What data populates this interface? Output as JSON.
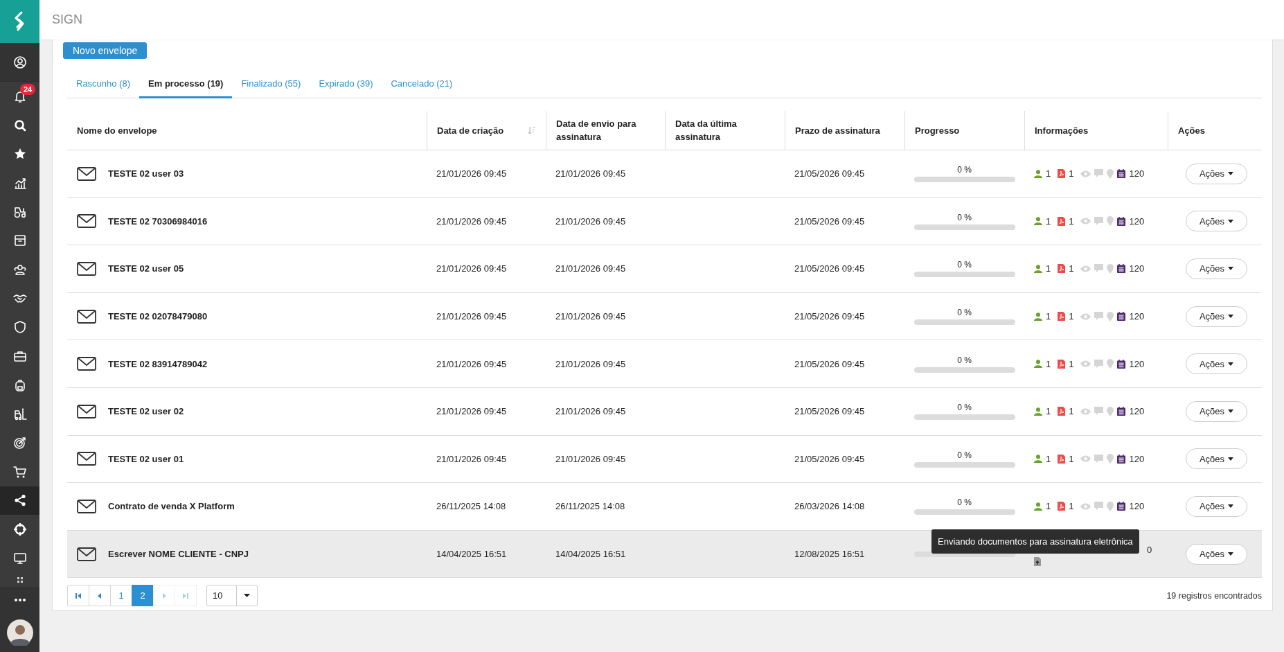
{
  "sidebar": {
    "items": [
      {
        "selected": false
      },
      {
        "selected": false,
        "badge": "24"
      },
      {
        "selected": false
      },
      {
        "selected": false
      },
      {
        "selected": false
      },
      {
        "selected": false
      },
      {
        "selected": false
      },
      {
        "selected": false
      },
      {
        "selected": false
      },
      {
        "selected": false
      },
      {
        "selected": false
      },
      {
        "selected": false
      },
      {
        "selected": false
      },
      {
        "selected": false
      },
      {
        "selected": false
      },
      {
        "selected": true
      },
      {
        "selected": false
      },
      {
        "selected": false
      },
      {
        "selected": false
      },
      {
        "selected": false
      }
    ]
  },
  "header": {
    "title": "SIGN"
  },
  "new_button": "Novo envelope",
  "tabs": [
    {
      "label": "Rascunho (8)",
      "selected": false
    },
    {
      "label": "Em processo (19)",
      "selected": true
    },
    {
      "label": "Finalizado (55)",
      "selected": false
    },
    {
      "label": "Expirado (39)",
      "selected": false
    },
    {
      "label": "Cancelado (21)",
      "selected": false
    }
  ],
  "table": {
    "columns": [
      {
        "label": "Nome do envelope"
      },
      {
        "label": "Data de criação",
        "sort_icon": true
      },
      {
        "label": "Data de envio para assinatura"
      },
      {
        "label": "Data da última assinatura"
      },
      {
        "label": "Prazo de assinatura"
      },
      {
        "label": "Progresso"
      },
      {
        "label": "Informações"
      },
      {
        "label": "Ações"
      }
    ],
    "rows": [
      {
        "kind": "normal",
        "hovered": false,
        "name": "TESTE 02 user 03",
        "created": "21/01/2026 09:45",
        "sent": "21/01/2026 09:45",
        "deadline": "21/05/2026 09:45",
        "progress_text": "0 %",
        "level": 0,
        "signers": "1",
        "documents": "1",
        "viewed": false,
        "commented": false,
        "located": false,
        "days": "120",
        "action": "Ações"
      },
      {
        "kind": "normal",
        "hovered": false,
        "name": "TESTE 02 70306984016",
        "created": "21/01/2026 09:45",
        "sent": "21/01/2026 09:45",
        "deadline": "21/05/2026 09:45",
        "progress_text": "0 %",
        "level": 0,
        "signers": "1",
        "documents": "1",
        "viewed": false,
        "commented": false,
        "located": false,
        "days": "120",
        "action": "Ações"
      },
      {
        "kind": "normal",
        "hovered": false,
        "name": "TESTE 02 user 05",
        "created": "21/01/2026 09:45",
        "sent": "21/01/2026 09:45",
        "deadline": "21/05/2026 09:45",
        "progress_text": "0 %",
        "level": 0,
        "signers": "1",
        "documents": "1",
        "viewed": false,
        "commented": false,
        "located": false,
        "days": "120",
        "action": "Ações"
      },
      {
        "kind": "normal",
        "hovered": false,
        "name": "TESTE 02 02078479080",
        "created": "21/01/2026 09:45",
        "sent": "21/01/2026 09:45",
        "deadline": "21/05/2026 09:45",
        "progress_text": "0 %",
        "level": 0,
        "signers": "1",
        "documents": "1",
        "viewed": false,
        "commented": false,
        "located": false,
        "days": "120",
        "action": "Ações"
      },
      {
        "kind": "normal",
        "hovered": false,
        "name": "TESTE 02 83914789042",
        "created": "21/01/2026 09:45",
        "sent": "21/01/2026 09:45",
        "deadline": "21/05/2026 09:45",
        "progress_text": "0 %",
        "level": 0,
        "signers": "1",
        "documents": "1",
        "viewed": false,
        "commented": false,
        "located": false,
        "days": "120",
        "action": "Ações"
      },
      {
        "kind": "normal",
        "hovered": false,
        "name": "TESTE 02 user 02",
        "created": "21/01/2026 09:45",
        "sent": "21/01/2026 09:45",
        "deadline": "21/05/2026 09:45",
        "progress_text": "0 %",
        "level": 0,
        "signers": "1",
        "documents": "1",
        "viewed": false,
        "commented": false,
        "located": false,
        "days": "120",
        "action": "Ações"
      },
      {
        "kind": "normal",
        "hovered": false,
        "name": "TESTE 02 user 01",
        "created": "21/01/2026 09:45",
        "sent": "21/01/2026 09:45",
        "deadline": "21/05/2026 09:45",
        "progress_text": "0 %",
        "level": 0,
        "signers": "1",
        "documents": "1",
        "viewed": false,
        "commented": false,
        "located": false,
        "days": "120",
        "action": "Ações"
      },
      {
        "kind": "normal",
        "hovered": false,
        "name": "Contrato de venda X Platform",
        "created": "26/11/2025 14:08",
        "sent": "26/11/2025 14:08",
        "deadline": "26/03/2026 14:08",
        "progress_text": "0 %",
        "level": 0,
        "signers": "1",
        "documents": "1",
        "viewed": false,
        "commented": false,
        "located": false,
        "days": "120",
        "action": "Ações"
      },
      {
        "kind": "sending",
        "hovered": true,
        "name": "Escrever NOME CLIENTE - CNPJ",
        "created": "14/04/2025 16:51",
        "sent": "14/04/2025 16:51",
        "deadline": "12/08/2025 16:51",
        "level": 0,
        "days_fragment": "0",
        "tooltip": "Enviando documentos para assinatura eletrônica",
        "action": "Ações"
      }
    ]
  },
  "pagination": {
    "pages": [
      {
        "label": "1",
        "selected": false
      },
      {
        "label": "2",
        "selected": true
      }
    ],
    "page_size": "10",
    "records": "19 registros encontrados"
  }
}
